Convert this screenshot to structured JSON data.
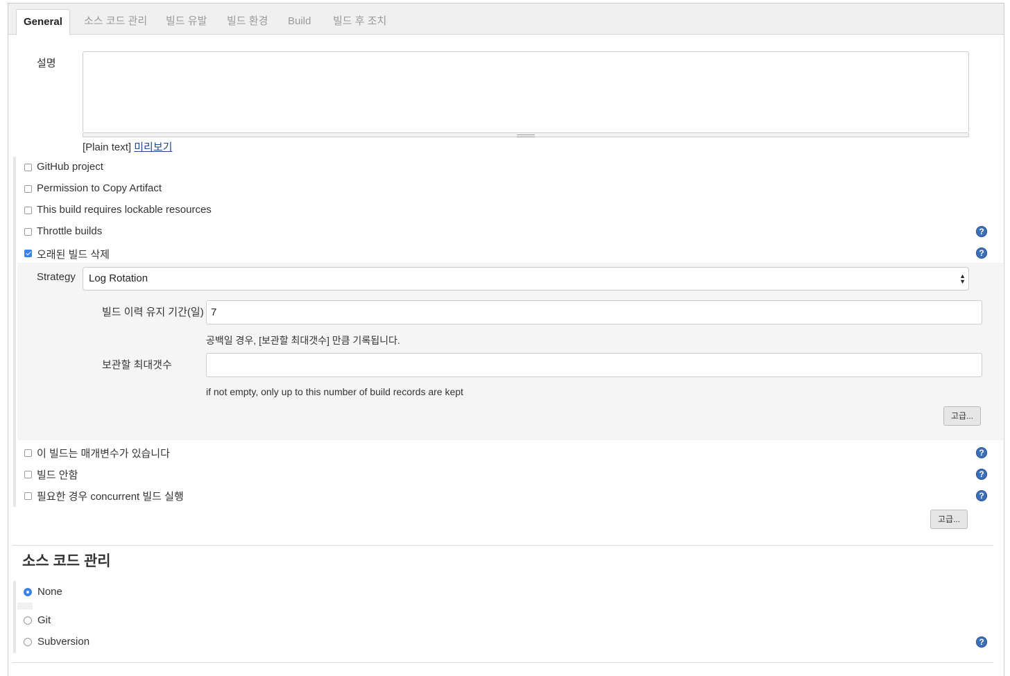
{
  "tabs": [
    {
      "label": "General",
      "active": true
    },
    {
      "label": "소스 코드 관리"
    },
    {
      "label": "빌드 유발"
    },
    {
      "label": "빌드 환경"
    },
    {
      "label": "Build"
    },
    {
      "label": "빌드 후 조치"
    }
  ],
  "description": {
    "label": "설명",
    "value": "",
    "format_text": "[Plain text]",
    "preview_link": "미리보기"
  },
  "options": [
    {
      "label": "GitHub project",
      "checked": false
    },
    {
      "label": "Permission to Copy Artifact",
      "checked": false
    },
    {
      "label": "This build requires lockable resources",
      "checked": false
    },
    {
      "label": "Throttle builds",
      "checked": false
    },
    {
      "label": "오래된 빌드 삭제",
      "checked": true
    }
  ],
  "discard": {
    "strategy_label": "Strategy",
    "strategy_value": "Log Rotation",
    "days_label": "빌드 이력 유지 기간(일)",
    "days_value": "7",
    "days_hint": "공백일 경우, [보관할 최대갯수] 만큼 기록됩니다.",
    "max_label": "보관할 최대갯수",
    "max_value": "",
    "max_hint": "if not empty, only up to this number of build records are kept",
    "advanced_button": "고급..."
  },
  "options_after": [
    {
      "label": "이 빌드는 매개변수가 있습니다",
      "checked": false
    },
    {
      "label": "빌드 안함",
      "checked": false
    },
    {
      "label": "필요한 경우 concurrent 빌드 실행",
      "checked": false
    }
  ],
  "general_advanced_button": "고급...",
  "scm": {
    "title": "소스 코드 관리",
    "options": [
      {
        "label": "None",
        "selected": true
      },
      {
        "label": "Git",
        "selected": false
      },
      {
        "label": "Subversion",
        "selected": false
      }
    ]
  },
  "help_icon_glyph": "?",
  "colors": {
    "accent": "#3b82e6",
    "help": "#3b6fb6",
    "link": "#204a87"
  }
}
